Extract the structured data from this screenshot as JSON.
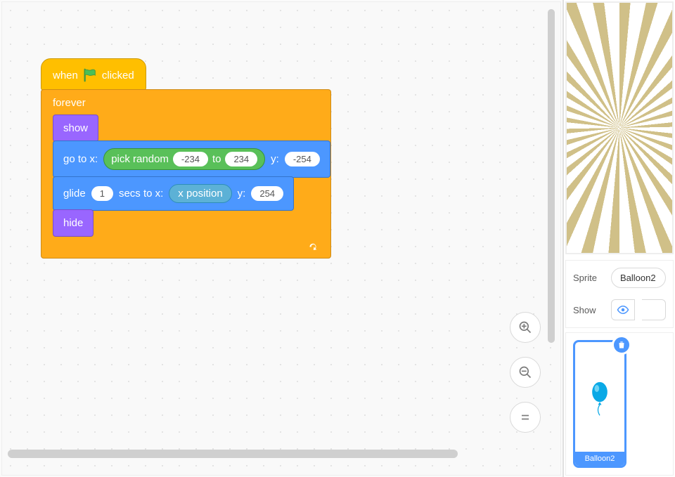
{
  "hat": {
    "pre": "when",
    "post": "clicked",
    "icon": "green-flag-icon"
  },
  "forever": {
    "label": "forever"
  },
  "show": {
    "label": "show"
  },
  "hide": {
    "label": "hide"
  },
  "goto": {
    "pre": "go to x:",
    "y_label": "y:",
    "y": "-254",
    "random": {
      "pre": "pick random",
      "from": "-234",
      "mid": "to",
      "to": "234"
    }
  },
  "glide": {
    "pre": "glide",
    "secs": "1",
    "mid": "secs to x:",
    "xpos": "x position",
    "y_label": "y:",
    "y": "254"
  },
  "panel": {
    "sprite_label": "Sprite",
    "sprite_name": "Balloon2",
    "show_label": "Show"
  },
  "sprite": {
    "caption": "Balloon2"
  }
}
